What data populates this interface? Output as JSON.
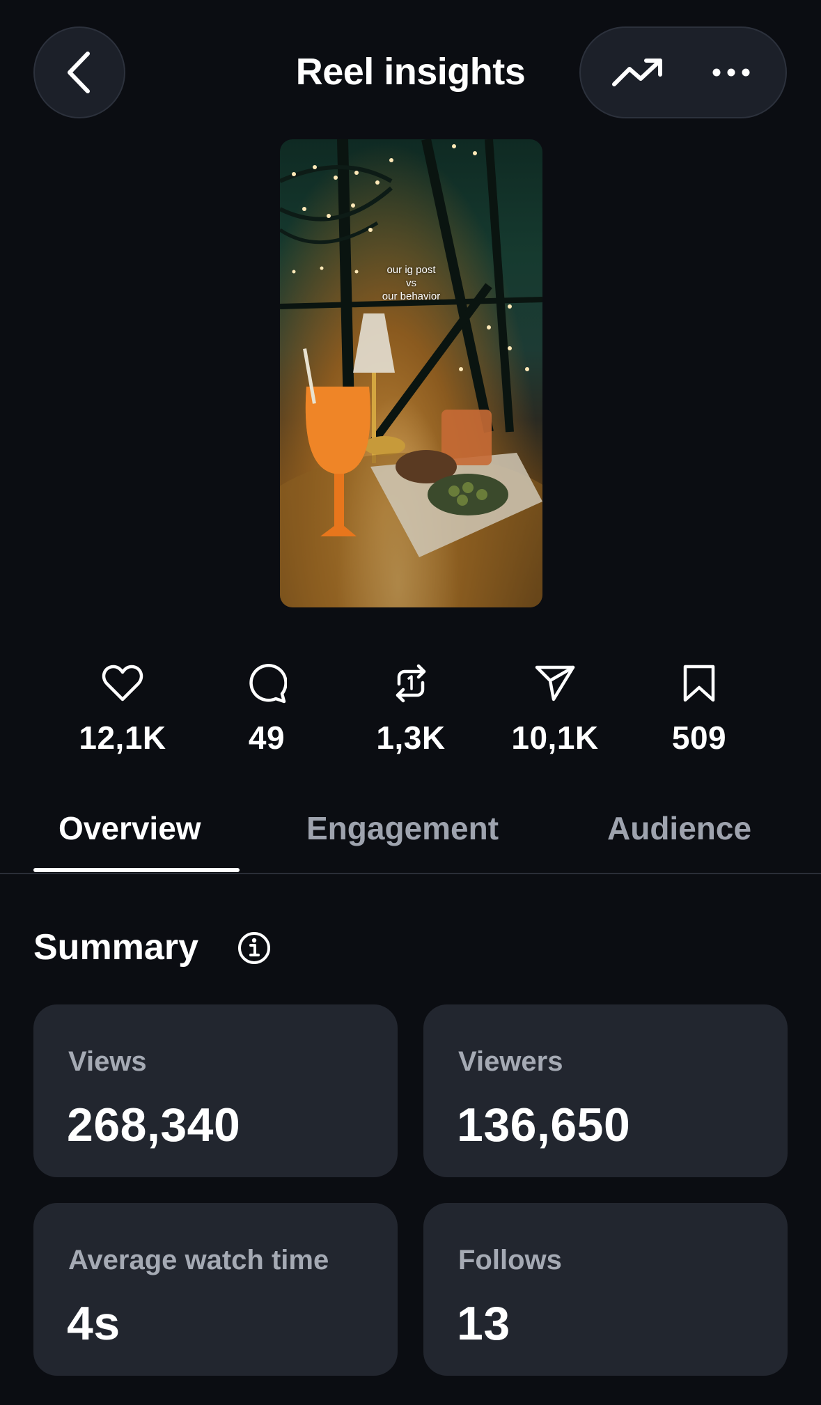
{
  "header": {
    "title": "Reel insights",
    "back_icon": "chevron-left-icon",
    "trend_icon": "trending-up-icon",
    "more_icon": "more-horizontal-icon"
  },
  "thumbnail": {
    "caption": "our ig post\nvs\nour behavior"
  },
  "stats": [
    {
      "icon": "heart-icon",
      "value": "12,1K"
    },
    {
      "icon": "comment-icon",
      "value": "49"
    },
    {
      "icon": "repost-icon",
      "value": "1,3K"
    },
    {
      "icon": "send-icon",
      "value": "10,1K"
    },
    {
      "icon": "bookmark-icon",
      "value": "509"
    }
  ],
  "tabs": [
    {
      "label": "Overview",
      "active": true
    },
    {
      "label": "Engagement",
      "active": false
    },
    {
      "label": "Audience",
      "active": false
    }
  ],
  "summary": {
    "title": "Summary",
    "cards": [
      {
        "label": "Views",
        "value": "268,340"
      },
      {
        "label": "Viewers",
        "value": "136,650"
      },
      {
        "label": "Average watch time",
        "value": "4s"
      },
      {
        "label": "Follows",
        "value": "13"
      }
    ]
  },
  "colors": {
    "background": "#0b0d12",
    "card": "#22262f",
    "muted_text": "#9ea3ae"
  }
}
